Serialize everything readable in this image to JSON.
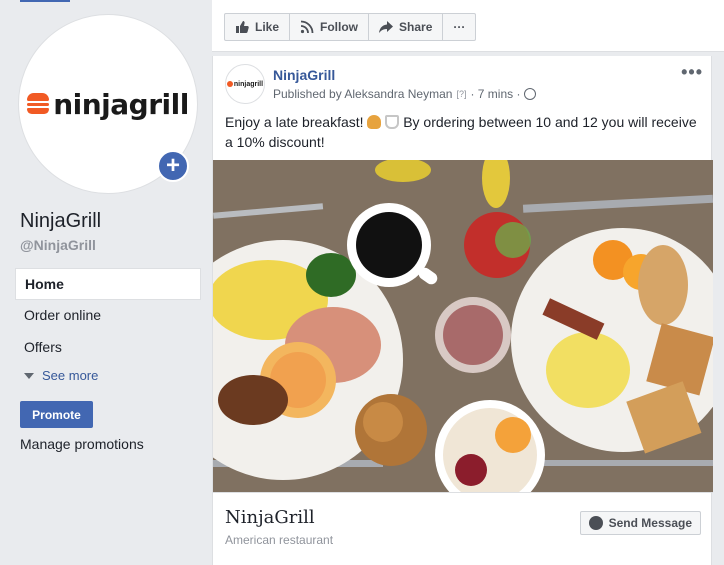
{
  "sidebar": {
    "logo_text": "ninjagrill",
    "page_name": "NinjaGrill",
    "page_handle": "@NinjaGrill",
    "nav": [
      {
        "label": "Home",
        "active": true
      },
      {
        "label": "Order online",
        "active": false
      },
      {
        "label": "Offers",
        "active": false
      }
    ],
    "see_more": "See more",
    "promote": "Promote",
    "manage_promotions": "Manage promotions"
  },
  "actionbar": {
    "like": "Like",
    "follow": "Follow",
    "share": "Share",
    "more": "···"
  },
  "post": {
    "author": "NinjaGrill",
    "avatar_text": "ninjagrill",
    "published_by": "Published by Aleksandra Neyman",
    "help": "[?]",
    "time": "· 7 mins ·",
    "text_before": "Enjoy a late breakfast!",
    "text_after": "By ordering between 10 and 12 you will receive a 10% discount!",
    "menu": "•••",
    "image_description_icon": "breakfast-photo"
  },
  "footer": {
    "name": "NinjaGrill",
    "category": "American restaurant",
    "send_message": "Send Message"
  },
  "colors": {
    "brand_blue": "#4267b2",
    "link_blue": "#365899",
    "logo_orange": "#f15a24",
    "background": "#e9ebee"
  }
}
